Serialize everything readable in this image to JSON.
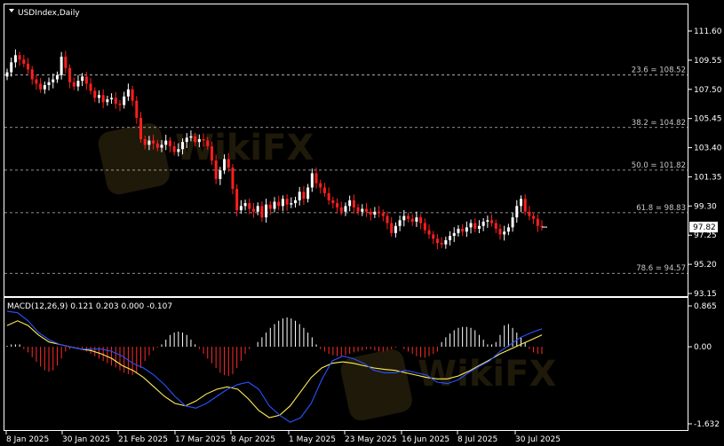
{
  "chart_data": [
    {
      "type": "candlestick",
      "title": "USDIndex,Daily",
      "ylim": [
        93.15,
        113.0
      ],
      "price_ticks": [
        "111.60",
        "109.55",
        "107.50",
        "105.45",
        "103.40",
        "101.35",
        "99.30",
        "97.25",
        "95.20",
        "93.15"
      ],
      "date_labels": [
        "8 Jan 2025",
        "30 Jan 2025",
        "21 Feb 2025",
        "17 Mar 2025",
        "8 Apr 2025",
        "1 May 2025",
        "23 May 2025",
        "16 Jun 2025",
        "8 Jul 2025",
        "30 Jul 2025"
      ],
      "current_price": "97.82",
      "fib_levels": [
        {
          "label": "23.6 = 108.52",
          "value": 108.52
        },
        {
          "label": "38.2 = 104.82",
          "value": 104.82
        },
        {
          "label": "50.0 = 101.82",
          "value": 101.82
        },
        {
          "label": "61.8 = 98.83",
          "value": 98.83
        },
        {
          "label": "78.6 = 94.57",
          "value": 94.57
        }
      ],
      "closes": [
        108.7,
        109.4,
        109.9,
        109.6,
        109.3,
        108.9,
        108.2,
        107.9,
        107.5,
        107.8,
        108.0,
        108.2,
        108.5,
        109.8,
        109.0,
        108.0,
        107.7,
        108.1,
        108.4,
        107.9,
        107.4,
        106.9,
        107.1,
        106.6,
        106.8,
        106.9,
        106.5,
        106.4,
        107.0,
        107.5,
        106.7,
        105.5,
        104.0,
        103.6,
        103.9,
        103.7,
        103.4,
        103.6,
        103.9,
        103.5,
        103.1,
        103.3,
        103.8,
        104.1,
        104.2,
        103.8,
        104.0,
        103.9,
        103.5,
        102.5,
        101.2,
        101.8,
        102.6,
        102.0,
        100.5,
        99.0,
        99.3,
        99.5,
        99.1,
        98.9,
        99.3,
        98.5,
        99.4,
        99.1,
        99.6,
        99.3,
        99.8,
        99.4,
        99.5,
        99.7,
        100.3,
        99.8,
        100.6,
        101.6,
        100.9,
        100.6,
        100.2,
        99.7,
        99.5,
        99.2,
        98.9,
        99.3,
        99.7,
        99.2,
        98.9,
        99.1,
        98.9,
        98.7,
        98.9,
        98.8,
        98.6,
        98.1,
        97.4,
        97.9,
        98.3,
        98.6,
        98.4,
        98.2,
        98.5,
        98.1,
        97.6,
        97.3,
        97.0,
        96.7,
        96.6,
        96.9,
        97.2,
        97.4,
        97.7,
        97.5,
        97.8,
        98.1,
        97.7,
        97.9,
        98.2,
        98.3,
        98.1,
        97.7,
        97.3,
        97.5,
        97.8,
        98.5,
        99.3,
        99.8,
        98.9,
        98.6,
        98.4,
        97.9,
        97.82
      ],
      "macd": {
        "label": "MACD(12,26,9) 0.121 0.203 0.000 -0.107",
        "ylim": [
          -1.632,
          0.865
        ],
        "ticks": [
          "0.865",
          "0.00",
          "-1.632"
        ],
        "histogram": [
          0.02,
          0.05,
          0.05,
          0.05,
          -0.05,
          -0.12,
          -0.22,
          -0.32,
          -0.42,
          -0.5,
          -0.53,
          -0.5,
          -0.4,
          -0.25,
          -0.1,
          -0.05,
          -0.03,
          -0.02,
          -0.05,
          -0.1,
          -0.15,
          -0.2,
          -0.25,
          -0.3,
          -0.35,
          -0.4,
          -0.44,
          -0.5,
          -0.55,
          -0.58,
          -0.6,
          -0.55,
          -0.45,
          -0.3,
          -0.18,
          -0.08,
          -0.02,
          0.05,
          0.15,
          0.25,
          0.3,
          0.32,
          0.3,
          0.25,
          0.15,
          0.05,
          -0.05,
          -0.15,
          -0.25,
          -0.35,
          -0.45,
          -0.55,
          -0.6,
          -0.62,
          -0.58,
          -0.45,
          -0.3,
          -0.15,
          -0.05,
          0.0,
          0.1,
          0.2,
          0.3,
          0.4,
          0.48,
          0.55,
          0.6,
          0.62,
          0.6,
          0.55,
          0.48,
          0.4,
          0.3,
          0.2,
          0.05,
          -0.05,
          -0.1,
          -0.15,
          -0.18,
          -0.2,
          -0.2,
          -0.18,
          -0.15,
          -0.12,
          -0.1,
          -0.08,
          -0.05,
          -0.05,
          -0.08,
          -0.1,
          -0.1,
          -0.08,
          -0.05,
          -0.02,
          0.0,
          -0.05,
          -0.1,
          -0.15,
          -0.2,
          -0.22,
          -0.23,
          -0.2,
          -0.15,
          -0.1,
          0.1,
          0.2,
          0.28,
          0.35,
          0.4,
          0.42,
          0.42,
          0.4,
          0.35,
          0.25,
          0.15,
          0.05,
          0.05,
          0.1,
          0.25,
          0.45,
          0.48,
          0.4,
          0.3,
          0.2,
          0.1,
          -0.05,
          -0.12,
          -0.15,
          -0.15
        ],
        "macd_line": [
          0.75,
          0.72,
          0.55,
          0.3,
          0.15,
          0.05,
          0.0,
          -0.05,
          -0.05,
          -0.05,
          -0.1,
          -0.2,
          -0.35,
          -0.45,
          -0.6,
          -0.8,
          -1.05,
          -1.25,
          -1.3,
          -1.2,
          -1.05,
          -0.9,
          -0.8,
          -0.75,
          -0.9,
          -1.25,
          -1.45,
          -1.6,
          -1.5,
          -1.2,
          -0.7,
          -0.3,
          -0.2,
          -0.25,
          -0.35,
          -0.5,
          -0.55,
          -0.55,
          -0.5,
          -0.55,
          -0.6,
          -0.75,
          -0.78,
          -0.7,
          -0.55,
          -0.42,
          -0.3,
          -0.1,
          0.05,
          0.2,
          0.3,
          0.38
        ],
        "signal_line": [
          0.45,
          0.55,
          0.45,
          0.25,
          0.1,
          0.05,
          0.0,
          -0.05,
          -0.08,
          -0.15,
          -0.25,
          -0.4,
          -0.5,
          -0.65,
          -0.85,
          -1.05,
          -1.2,
          -1.25,
          -1.15,
          -1.0,
          -0.9,
          -0.85,
          -0.9,
          -1.1,
          -1.35,
          -1.5,
          -1.45,
          -1.25,
          -0.95,
          -0.65,
          -0.45,
          -0.35,
          -0.32,
          -0.35,
          -0.4,
          -0.45,
          -0.48,
          -0.5,
          -0.55,
          -0.6,
          -0.65,
          -0.68,
          -0.68,
          -0.62,
          -0.52,
          -0.4,
          -0.28,
          -0.15,
          -0.05,
          0.05,
          0.15,
          0.25
        ]
      }
    }
  ],
  "colors": {
    "background": "#000000",
    "bull": "#ffffff",
    "bear": "#ff1e1e",
    "grid": "#ffffff",
    "macd_line": "#2a52ff",
    "signal_line": "#ffee55",
    "hist_pos": "#ffffff",
    "hist_neg": "#ff2a2a",
    "watermark": "#3a2e12"
  },
  "watermark_text": "WikiFX"
}
